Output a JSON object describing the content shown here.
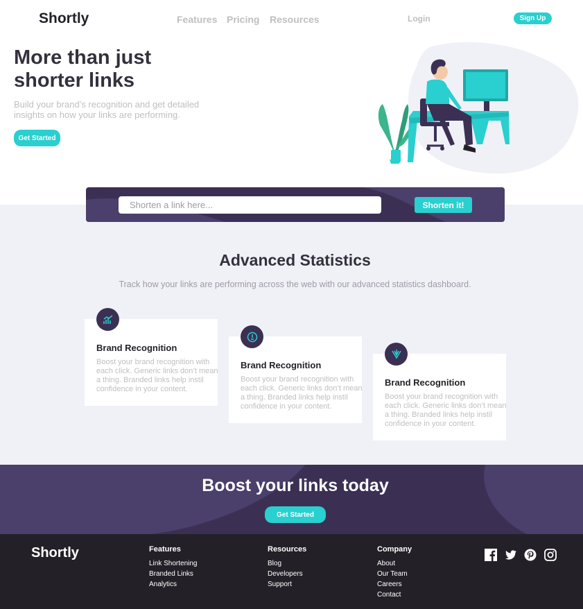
{
  "header": {
    "logo": "Shortly",
    "nav": [
      {
        "label": "Features"
      },
      {
        "label": "Pricing"
      },
      {
        "label": "Resources"
      }
    ],
    "login": "Login",
    "signup": "Sign Up"
  },
  "hero": {
    "title": "More than just shorter links",
    "subtitle": "Build your brand’s recognition and get detailed insights on how your links are performing.",
    "cta": "Get Started"
  },
  "shorten": {
    "placeholder": "Shorten a link here...",
    "button": "Shorten it!"
  },
  "stats": {
    "title": "Advanced Statistics",
    "subtitle": "Track how your links are performing across the web with our advanced statistics dashboard.",
    "cards": [
      {
        "icon": "brand-recognition-icon",
        "title": "Brand Recognition",
        "text": "Boost your brand recognition with each click. Generic links don’t mean a thing. Branded links help instil confidence in your content."
      },
      {
        "icon": "detailed-records-icon",
        "title": "Brand Recognition",
        "text": "Boost your brand recognition with each click. Generic links don’t mean a thing. Branded links help instil confidence in your content."
      },
      {
        "icon": "fully-customizable-icon",
        "title": "Brand Recognition",
        "text": "Boost your brand recognition with each click. Generic links don’t mean a thing. Branded links help instil confidence in your content."
      }
    ]
  },
  "boost": {
    "title": "Boost your links today",
    "cta": "Get Started"
  },
  "footer": {
    "logo": "Shortly",
    "columns": [
      {
        "title": "Features",
        "links": [
          "Link Shortening",
          "Branded Links",
          "Analytics"
        ]
      },
      {
        "title": "Resources",
        "links": [
          "Blog",
          "Developers",
          "Support"
        ]
      },
      {
        "title": "Company",
        "links": [
          "About",
          "Our Team",
          "Careers",
          "Contact"
        ]
      }
    ],
    "social": [
      "facebook-icon",
      "twitter-icon",
      "pinterest-icon",
      "instagram-icon"
    ]
  },
  "colors": {
    "accent": "#2acfcf",
    "dark_violet": "#3b3054",
    "very_dark": "#232127",
    "gray_bg": "#f0f1f6",
    "text_gray": "#bfbfbf"
  }
}
